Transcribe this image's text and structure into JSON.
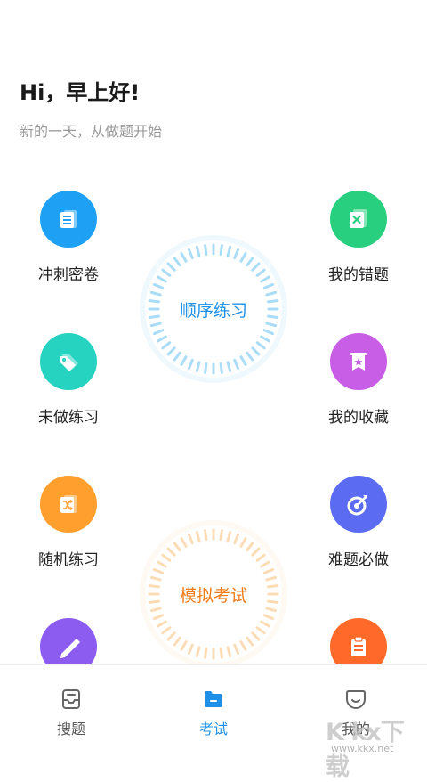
{
  "header": {
    "greeting": "Hi，早上好!",
    "subtitle": "新的一天，从做题开始"
  },
  "features": {
    "sprint_papers": {
      "label": "冲刺密卷",
      "icon": "document-icon",
      "color": "#1ea0f5"
    },
    "my_mistakes": {
      "label": "我的错题",
      "icon": "error-book-icon",
      "color": "#27cf7e"
    },
    "undone_practice": {
      "label": "未做练习",
      "icon": "tag-icon",
      "color": "#25d3c0"
    },
    "my_favorites": {
      "label": "我的收藏",
      "icon": "star-bookmark-icon",
      "color": "#c85de6"
    },
    "random_practice": {
      "label": "随机练习",
      "icon": "shuffle-icon",
      "color": "#ff9f2e"
    },
    "hard_questions": {
      "label": "难题必做",
      "icon": "target-icon",
      "color": "#5b6cf2"
    },
    "partial_left": {
      "icon": "pencil-icon",
      "color": "#8c5cf0"
    },
    "partial_right": {
      "icon": "clipboard-icon",
      "color": "#ff6a2a"
    }
  },
  "rings": {
    "sequential": {
      "label": "顺序练习",
      "color": "#1e90e8",
      "tick_color": "#a9dcf6"
    },
    "mock_exam": {
      "label": "模拟考试",
      "color": "#f07c1a",
      "tick_color": "#fbdcb5"
    }
  },
  "tabbar": {
    "search": {
      "label": "搜题",
      "icon": "inbox-search-icon"
    },
    "exam": {
      "label": "考试",
      "icon": "folder-icon",
      "active": true,
      "color": "#1e90e8"
    },
    "mine": {
      "label": "我的",
      "icon": "smile-icon"
    }
  },
  "watermark": {
    "text": "K kx下载",
    "sub": "www.kkx.net"
  }
}
